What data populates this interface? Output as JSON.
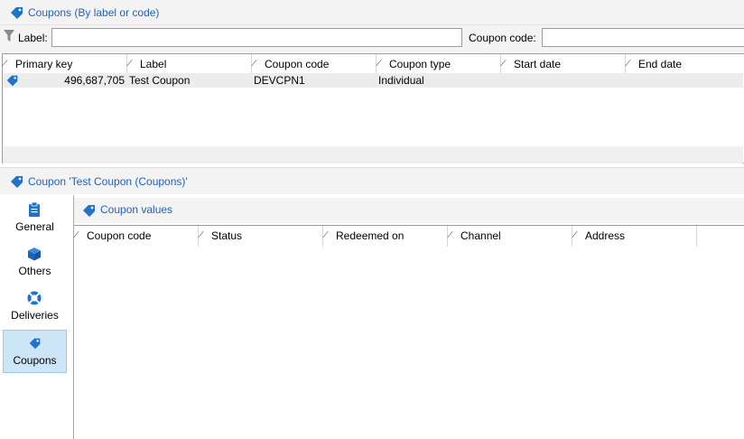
{
  "top_header": {
    "title": "Coupons (By label or code)"
  },
  "filters": {
    "label_caption": "Label:",
    "label_value": "",
    "code_caption": "Coupon code:",
    "code_value": ""
  },
  "list": {
    "columns": [
      "Primary key",
      "Label",
      "Coupon code",
      "Coupon type",
      "Start date",
      "End date"
    ],
    "rows": [
      {
        "primary_key": "496,687,705",
        "label": "Test Coupon",
        "coupon_code": "DEVCPN1",
        "coupon_type": "Individual",
        "start_date": "",
        "end_date": ""
      }
    ]
  },
  "detail": {
    "title": "Coupon 'Test Coupon (Coupons)'"
  },
  "nav": {
    "items": [
      {
        "label": "General",
        "icon": "clipboard-icon"
      },
      {
        "label": "Others",
        "icon": "cube-icon"
      },
      {
        "label": "Deliveries",
        "icon": "lifebuoy-icon"
      },
      {
        "label": "Coupons",
        "icon": "tag-icon",
        "active": true
      }
    ]
  },
  "values": {
    "title": "Coupon values",
    "columns": [
      "Coupon code",
      "Status",
      "Redeemed on",
      "Channel",
      "Address"
    ]
  },
  "colors": {
    "accent": "#1f63b8",
    "active_nav": "#cde6f7",
    "sort_red": "#c0392b"
  }
}
